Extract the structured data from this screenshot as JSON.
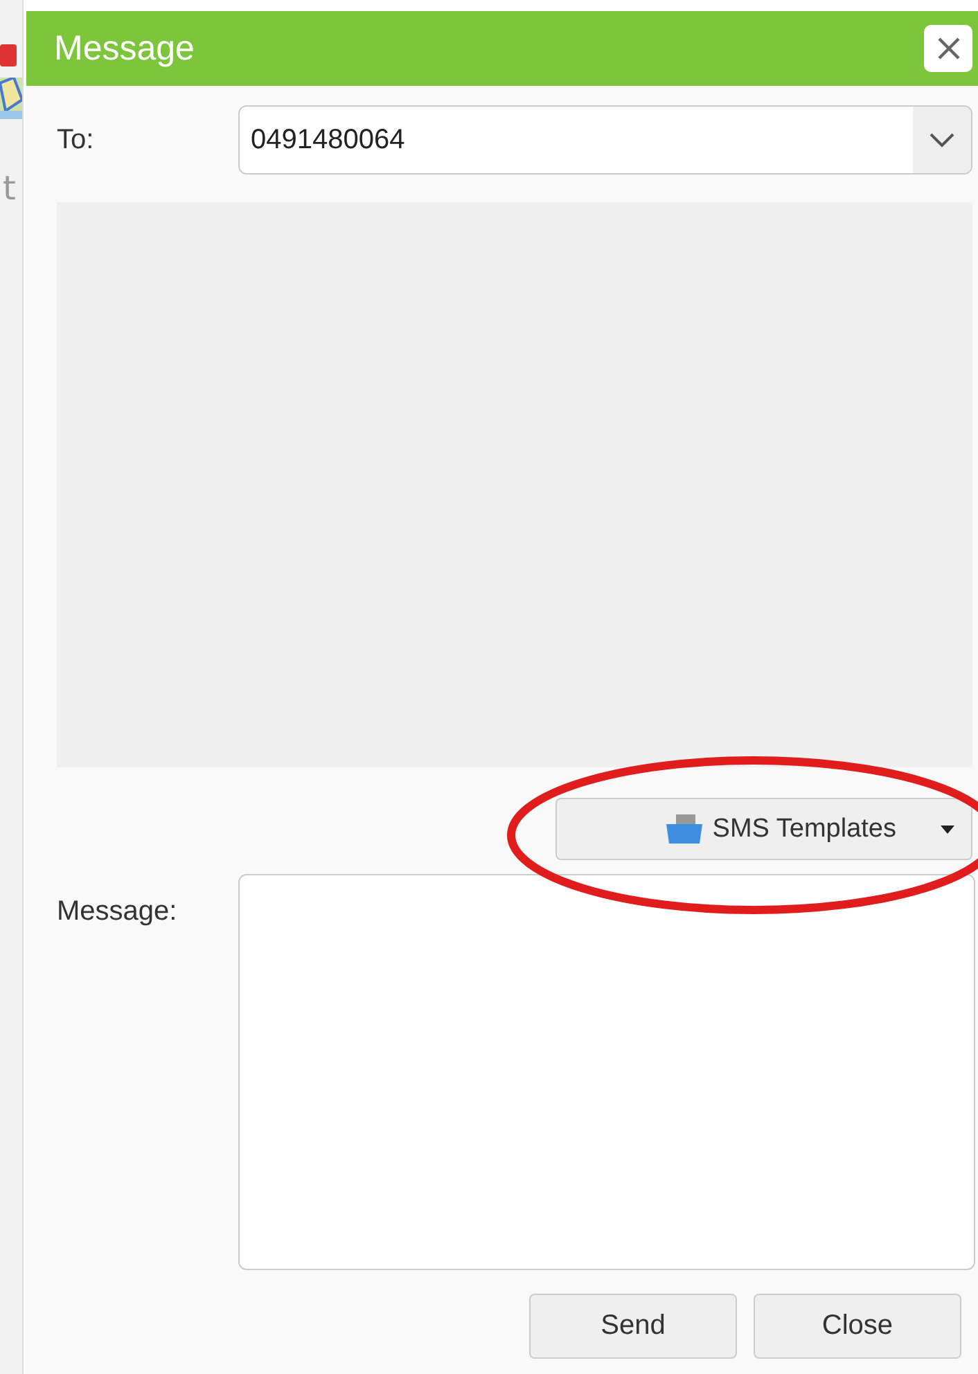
{
  "background": {
    "partial_text": "t"
  },
  "dialog": {
    "title": "Message"
  },
  "to": {
    "label": "To:",
    "value": "0491480064"
  },
  "templates_button": {
    "label": "SMS Templates"
  },
  "message": {
    "label": "Message:"
  },
  "buttons": [
    {
      "label": "Send"
    },
    {
      "label": "Close"
    }
  ]
}
